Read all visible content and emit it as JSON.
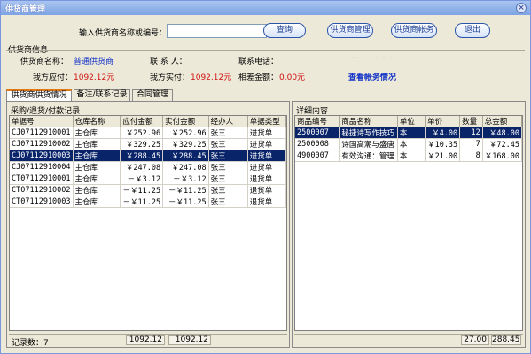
{
  "window": {
    "title": "供货商管理",
    "close_glyph": "×"
  },
  "search": {
    "label": "输入供货商名称或编号：",
    "value": "",
    "placeholder": ""
  },
  "buttons": {
    "query": "查询",
    "manage": "供货商管理",
    "accounts": "供货商帐务",
    "exit": "退出"
  },
  "supplier_info": {
    "section_title": "供货商信息",
    "name_label": "供货商名称：",
    "name_value": "普通供货商",
    "contact_label": "联 系 人：",
    "contact_value": "",
    "phone_label": "联系电话：",
    "phone_value": "",
    "payable_label": "我方应付：",
    "payable_value": "1092.12元",
    "paid_label": "我方实付：",
    "paid_value": "1092.12元",
    "diff_label": "相差金额：",
    "diff_value": "0.00元",
    "dots": "... . . . . . .",
    "view_accounts_link": "查看帐务情况"
  },
  "tabs": [
    {
      "label": "供货商供货情况",
      "active": true
    },
    {
      "label": "备注/联系记录",
      "active": false
    },
    {
      "label": "合同管理",
      "active": false
    }
  ],
  "purchase_panel": {
    "title": "采购/退货/付款记录",
    "columns": [
      "单据号",
      "仓库名称",
      "应付金额",
      "实付金额",
      "经办人",
      "单据类型"
    ],
    "rows": [
      [
        "CJ07112910001",
        "主仓库",
        "￥252.96",
        "￥252.96",
        "张三",
        "进货单"
      ],
      [
        "CJ07112910002",
        "主仓库",
        "￥329.25",
        "￥329.25",
        "张三",
        "进货单"
      ],
      [
        "CJ07112910003",
        "主仓库",
        "￥288.45",
        "￥288.45",
        "张三",
        "进货单"
      ],
      [
        "CJ07112910004",
        "主仓库",
        "￥247.08",
        "￥247.08",
        "张三",
        "进货单"
      ],
      [
        "CT07112910001",
        "主仓库",
        "－￥3.12",
        "－￥3.12",
        "张三",
        "退货单"
      ],
      [
        "CT07112910002",
        "主仓库",
        "－￥11.25",
        "－￥11.25",
        "张三",
        "退货单"
      ],
      [
        "CT07112910003",
        "主仓库",
        "－￥11.25",
        "－￥11.25",
        "张三",
        "退货单"
      ]
    ],
    "selected_row": 2,
    "record_count_label": "记录数：7",
    "total_payable": "1092.12",
    "total_paid": "1092.12"
  },
  "detail_panel": {
    "title": "详细内容",
    "columns": [
      "商品编号",
      "商品名称",
      "单位",
      "单价",
      "数量",
      "总金额"
    ],
    "rows": [
      [
        "2500007",
        "秘捷诗写作技巧",
        "本",
        "￥4.00",
        "12",
        "￥48.00"
      ],
      [
        "2500008",
        "诗国高潮与盛唐",
        "本",
        "￥10.35",
        "7",
        "￥72.45"
      ],
      [
        "4900007",
        "有效沟通：管理",
        "本",
        "￥21.00",
        "8",
        "￥168.00"
      ]
    ],
    "selected_row": 0,
    "total_qty": "27.00",
    "total_amount": "288.45"
  }
}
